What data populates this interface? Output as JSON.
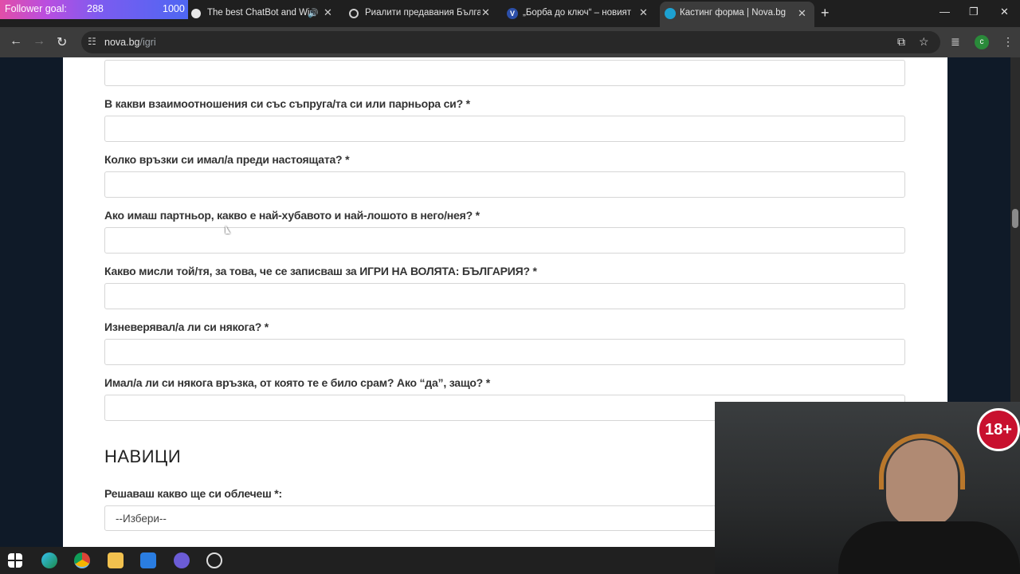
{
  "follower": {
    "label": "Follower goal:",
    "current": "288",
    "goal": "1000"
  },
  "tabs": [
    {
      "title": "The best ChatBot and Widg"
    },
    {
      "title": "Риалити предавания България"
    },
    {
      "title": "„Борба до ключ“ – новият риалити"
    },
    {
      "title": "Кастинг форма | Nova.bg"
    }
  ],
  "address": {
    "host": "nova.bg",
    "path": "/igri"
  },
  "questions": [
    {
      "label": "В какви взаимоотношения си със съпруга/та си или парньора си? *"
    },
    {
      "label": "Колко връзки си имал/а преди настоящата? *"
    },
    {
      "label": "Ако имаш партньор, какво е най-хубавото и най-лошото в него/нея? *"
    },
    {
      "label": "Какво мисли той/тя, за това, че се записваш за ИГРИ НА ВОЛЯТА: БЪЛГАРИЯ? *"
    },
    {
      "label": "Изневерявал/а ли си някога? *"
    },
    {
      "label": "Имал/а ли си някога връзка, от която те е било срам? Ако “да”, защо? *"
    }
  ],
  "section_title": "НАВИЦИ",
  "habits": {
    "question": "Решаваш какво ще си облечеш *:",
    "select_value": "--Избери--"
  },
  "overlay_badge": "18+",
  "colors": {
    "page_bg": "#ffffff",
    "label": "#333333",
    "badge": "#c8102e",
    "follower_gradient_start": "#e14ea8",
    "follower_gradient_end": "#4e67f2"
  }
}
